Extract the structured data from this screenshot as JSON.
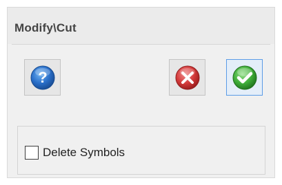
{
  "window": {
    "title": "Modify\\Cut"
  },
  "toolbar": {
    "help_icon": "question-icon",
    "cancel_icon": "close-icon",
    "ok_icon": "checkmark-icon"
  },
  "options": {
    "delete_symbols_label": "Delete Symbols",
    "delete_symbols_checked": false
  },
  "colors": {
    "help_blue": "#2a6fc9",
    "cancel_red": "#d33a3a",
    "ok_green": "#3fae3a",
    "focus_border": "#5a9be6"
  }
}
